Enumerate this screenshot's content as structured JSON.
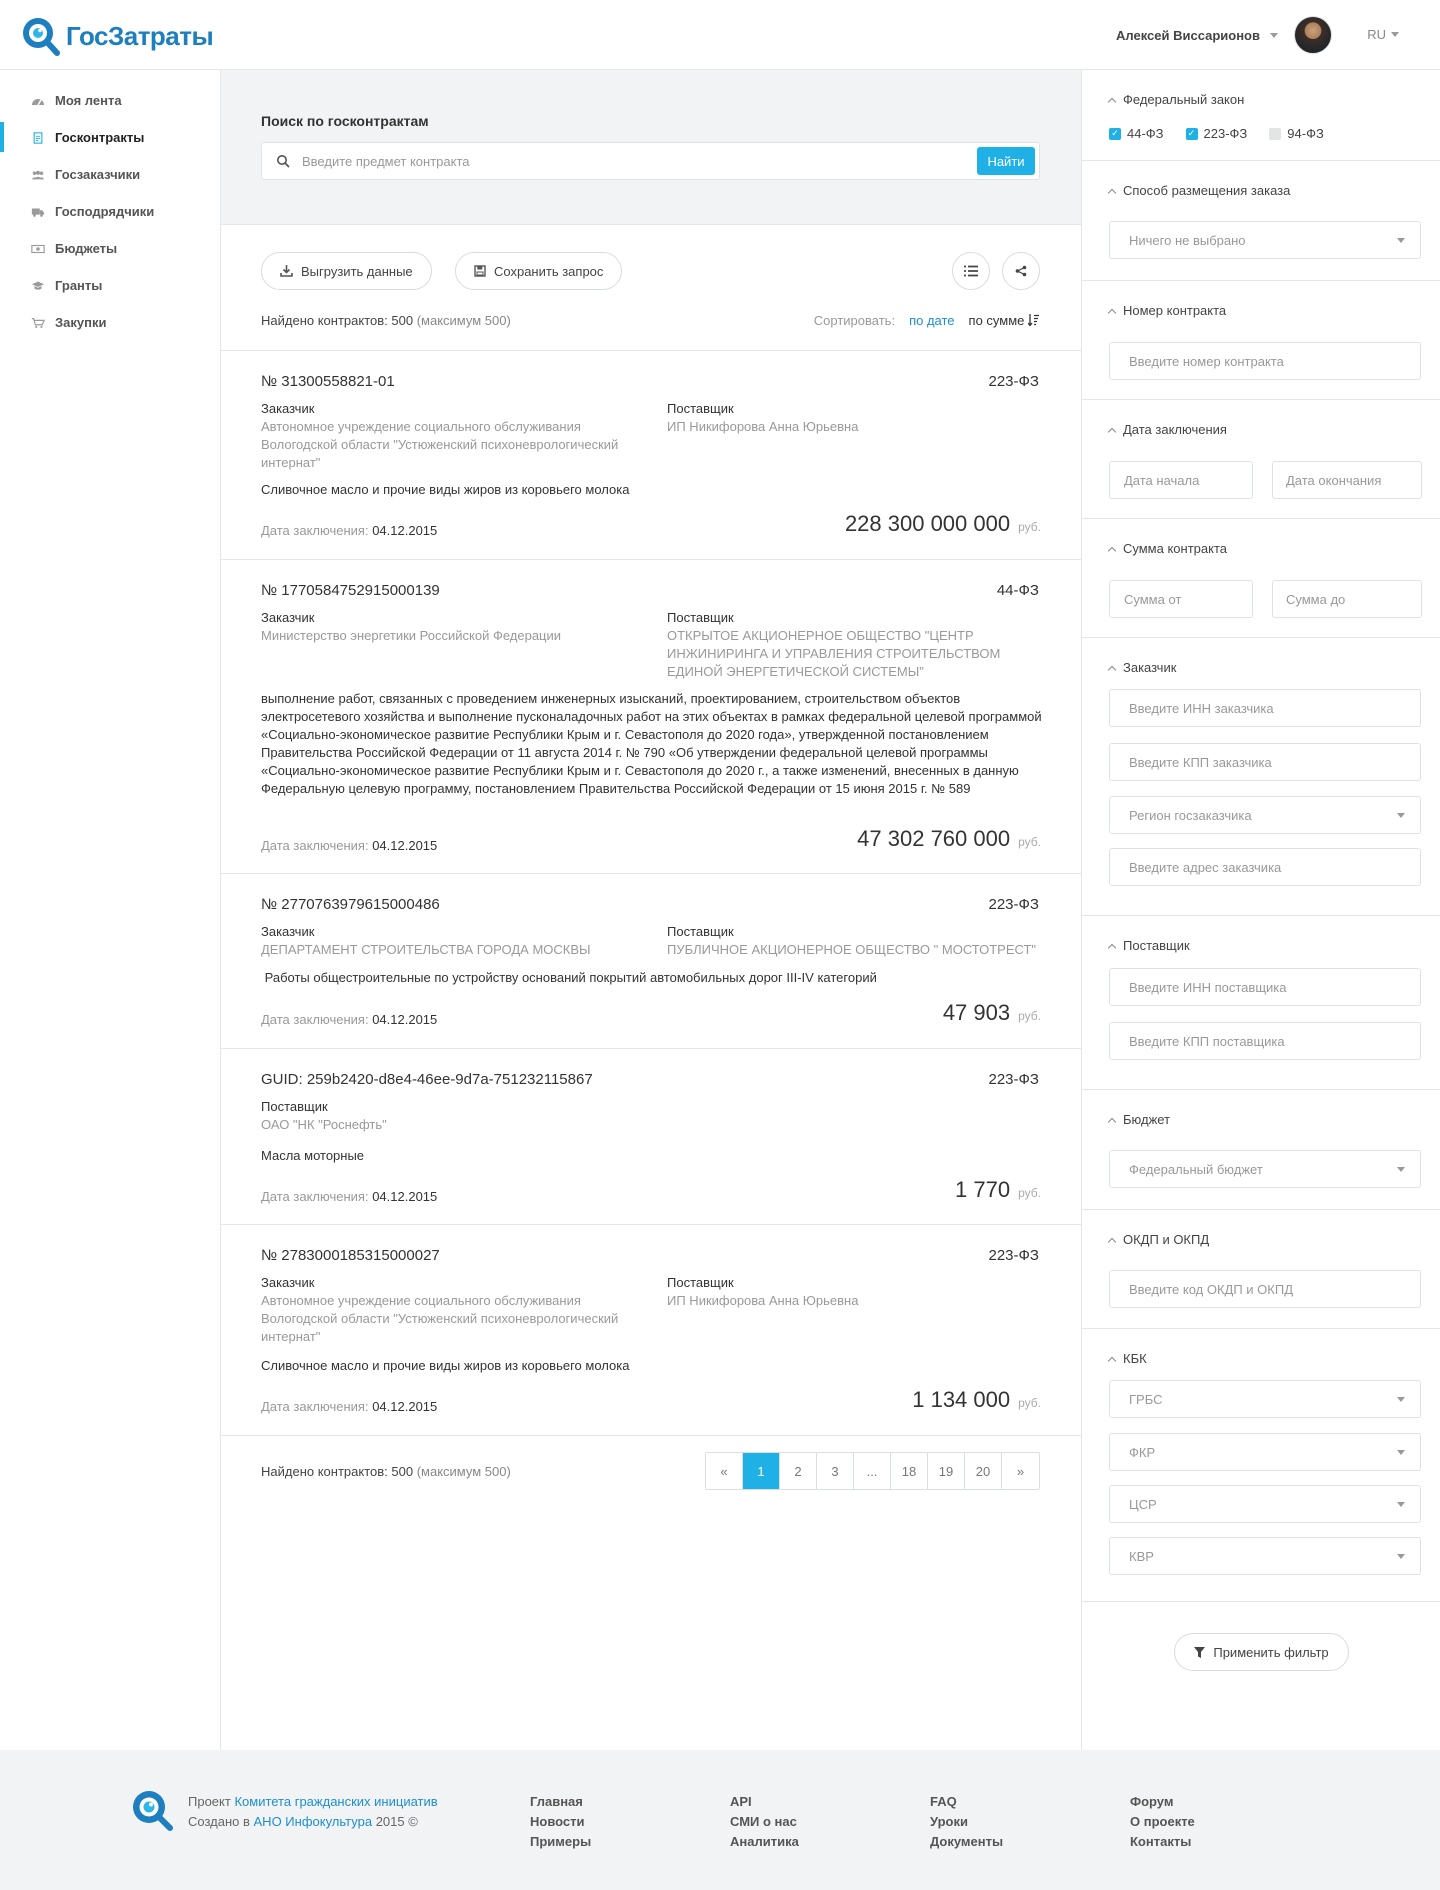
{
  "header": {
    "logo_text": "ГосЗатраты",
    "user_name": "Алексей Виссарионов",
    "lang": "RU"
  },
  "sidebar": {
    "items": [
      {
        "label": "Моя лента",
        "icon": "dashboard-icon"
      },
      {
        "label": "Госконтракты",
        "icon": "document-icon",
        "active": true
      },
      {
        "label": "Госзаказчики",
        "icon": "users-icon"
      },
      {
        "label": "Господрядчики",
        "icon": "truck-icon"
      },
      {
        "label": "Бюджеты",
        "icon": "money-icon"
      },
      {
        "label": "Гранты",
        "icon": "graduation-cap-icon"
      },
      {
        "label": "Закупки",
        "icon": "cart-icon"
      }
    ]
  },
  "search": {
    "title": "Поиск по госконтрактам",
    "placeholder": "Введите предмет контракта",
    "button": "Найти"
  },
  "toolbar": {
    "export_label": "Выгрузить данные",
    "save_label": "Сохранить запрос",
    "found_prefix": "Найдено контрактов:",
    "found_count": "500",
    "found_max": "(максимум 500)",
    "sort_label": "Сортировать:",
    "sort_by_date": "по дате",
    "sort_by_sum": "по сумме"
  },
  "labels": {
    "customer": "Заказчик",
    "supplier": "Поставщик",
    "date": "Дата заключения:",
    "currency": "руб."
  },
  "contracts": [
    {
      "number": "№ 31300558821-01",
      "law": "223-ФЗ",
      "customer": "Автономное учреждение социального обслуживания Вологодской области \"Устюженский психоневрологический интернат\"",
      "supplier": "ИП Никифорова Анна Юрьевна",
      "description": "Сливочное масло и прочие виды жиров из коровьего молока",
      "date": "04.12.2015",
      "sum": "228 300 000 000"
    },
    {
      "number": "№ 1770584752915000139",
      "law": "44-ФЗ",
      "customer": "Министерство энергетики Российской Федерации",
      "supplier": "ОТКРЫТОЕ АКЦИОНЕРНОЕ ОБЩЕСТВО \"ЦЕНТР ИНЖИНИРИНГА И УПРАВЛЕНИЯ СТРОИТЕЛЬСТВОМ ЕДИНОЙ ЭНЕРГЕТИЧЕСКОЙ СИСТЕМЫ\"",
      "description": "выполнение работ, связанных с проведением инженерных изысканий, проектированием, строительством объектов электросетевого хозяйства и выполнение пусконаладочных работ на этих объектах в рамках федеральной целевой программой «Социально-экономическое развитие Республики Крым и г. Севастополя до 2020 года», утвержденной постановлением Правительства Российской Федерации от 11 августа 2014 г. № 790 «Об утверждении федеральной целевой программы «Социально-экономическое развитие Республики Крым и г. Севастополя до 2020 г., а также изменений, внесенных в данную Федеральную целевую программу, постановлением Правительства Российской Федерации от 15 июня 2015 г. № 589",
      "date": "04.12.2015",
      "sum": "47 302 760 000"
    },
    {
      "number": "№ 2770763979615000486",
      "law": "223-ФЗ",
      "customer": "ДЕПАРТАМЕНТ СТРОИТЕЛЬСТВА ГОРОДА МОСКВЫ",
      "supplier": "ПУБЛИЧНОЕ АКЦИОНЕРНОЕ ОБЩЕСТВО \" МОСТОТРЕСТ\"",
      "description": " Работы общестроительные по устройству оснований покрытий автомобильных дорог III-IV категорий",
      "date": "04.12.2015",
      "sum": "47 903"
    },
    {
      "number": "GUID: 259b2420-d8e4-46ee-9d7a-751232115867",
      "law": "223-ФЗ",
      "supplier": "ОАО \"НК \"Роснефть\"",
      "description": "Масла моторные",
      "date": "04.12.2015",
      "sum": "1 770"
    },
    {
      "number": "№ 2783000185315000027",
      "law": "223-ФЗ",
      "customer": "Автономное учреждение социального обслуживания Вологодской области \"Устюженский психоневрологический интернат\"",
      "supplier": "ИП Никифорова Анна Юрьевна",
      "description": "Сливочное масло и прочие виды жиров из коровьего молока",
      "date": "04.12.2015",
      "sum": "1 134 000"
    }
  ],
  "pagination": {
    "pages": [
      "«",
      "1",
      "2",
      "3",
      "...",
      "18",
      "19",
      "20",
      "»"
    ],
    "current": "1"
  },
  "filters": {
    "law": {
      "title": "Федеральный закон",
      "options": [
        {
          "label": "44-ФЗ",
          "checked": true
        },
        {
          "label": "223-ФЗ",
          "checked": true
        },
        {
          "label": "94-ФЗ",
          "checked": false
        }
      ]
    },
    "placement": {
      "title": "Способ размещения заказа",
      "value": "Ничего не выбрано"
    },
    "number": {
      "title": "Номер контракта",
      "placeholder": "Введите номер контракта"
    },
    "date": {
      "title": "Дата заключения",
      "from": "Дата начала",
      "to": "Дата окончания"
    },
    "sum": {
      "title": "Сумма контракта",
      "from": "Сумма от",
      "to": "Сумма до"
    },
    "customer": {
      "title": "Заказчик",
      "inn": "Введите ИНН заказчика",
      "kpp": "Введите КПП заказчика",
      "region": "Регион госзаказчика",
      "address": "Введите адрес заказчика"
    },
    "supplier": {
      "title": "Поставщик",
      "inn": "Введите ИНН поставщика",
      "kpp": "Введите КПП поставщика"
    },
    "budget": {
      "title": "Бюджет",
      "value": "Федеральный бюджет"
    },
    "okdp": {
      "title": "ОКДП и ОКПД",
      "placeholder": "Введите код ОКДП и ОКПД"
    },
    "kbk": {
      "title": "КБК",
      "grbs": "ГРБС",
      "fkr": "ФКР",
      "csr": "ЦСР",
      "kvr": "КВР"
    },
    "apply": "Применить фильтр"
  },
  "footer": {
    "project_prefix": "Проект",
    "project_link": "Комитета гражданских инициатив",
    "created_prefix": "Создано в",
    "created_link": "АНО Инфокультура",
    "created_suffix": "2015 ©",
    "columns": [
      [
        "Главная",
        "Новости",
        "Примеры"
      ],
      [
        "API",
        "СМИ о нас",
        "Аналитика"
      ],
      [
        "FAQ",
        "Уроки",
        "Документы"
      ],
      [
        "Форум",
        "О проекте",
        "Контакты"
      ]
    ]
  },
  "colors": {
    "accent": "#1fb1e6",
    "brand": "#1d7fbf",
    "link": "#1d8ed0"
  }
}
